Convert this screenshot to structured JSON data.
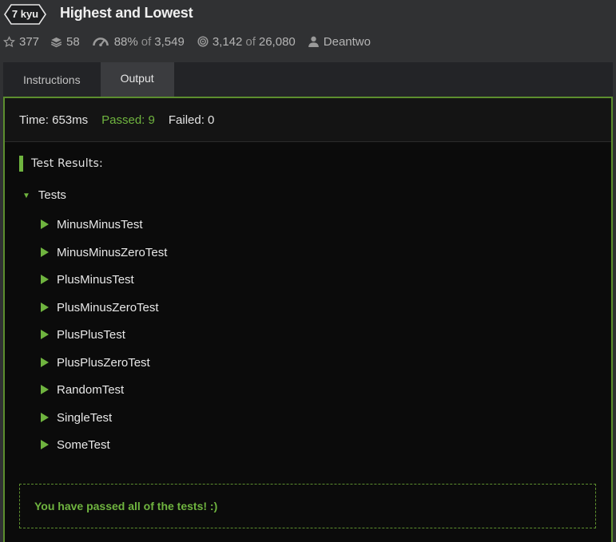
{
  "kata": {
    "rank": "7 kyu",
    "title": "Highest and Lowest",
    "stars": "377",
    "collections": "58",
    "satisfaction_pct": "88%",
    "satisfaction_of": "of",
    "satisfaction_total": "3,549",
    "completed": "3,142",
    "completed_of": "of",
    "attempts": "26,080",
    "author": "Deantwo"
  },
  "tabs": [
    {
      "label": "Instructions",
      "active": false
    },
    {
      "label": "Output",
      "active": true
    }
  ],
  "summary": {
    "time": "Time: 653ms",
    "passed": "Passed: 9",
    "failed": "Failed: 0"
  },
  "results": {
    "heading": "Test Results:",
    "group": "Tests",
    "tests": [
      "MinusMinusTest",
      "MinusMinusZeroTest",
      "PlusMinusTest",
      "PlusMinusZeroTest",
      "PlusPlusTest",
      "PlusPlusZeroTest",
      "RandomTest",
      "SingleTest",
      "SomeTest"
    ],
    "message": "You have passed all of the tests! :)"
  },
  "colors": {
    "accent_green": "#6fb43f",
    "background": "#303133",
    "panel": "#0b0b0b"
  }
}
